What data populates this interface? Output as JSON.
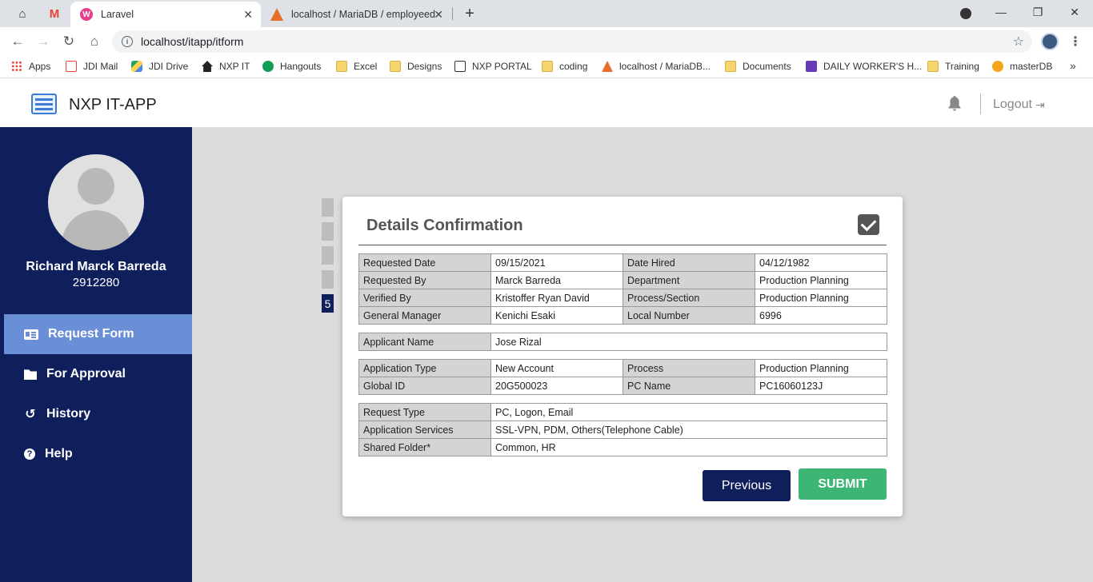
{
  "browser": {
    "tabs": [
      {
        "label": "Laravel"
      },
      {
        "label": "localhost / MariaDB / employeed"
      }
    ],
    "url": "localhost/itapp/itform",
    "bookmarks": [
      "Apps",
      "JDI Mail",
      "JDI Drive",
      "NXP IT",
      "Hangouts",
      "Excel",
      "Designs",
      "NXP PORTAL",
      "coding",
      "localhost / MariaDB...",
      "Documents",
      "DAILY WORKER'S H...",
      "Training",
      "masterDB"
    ],
    "more_bookmarks": "»"
  },
  "app": {
    "title": "NXP IT-APP",
    "logout_label": "Logout"
  },
  "sidebar": {
    "user_name": "Richard Marck Barreda",
    "user_id": "2912280",
    "items": [
      {
        "label": "Request Form",
        "active": true
      },
      {
        "label": "For Approval"
      },
      {
        "label": "History"
      },
      {
        "label": "Help"
      }
    ]
  },
  "steps": {
    "current": "5"
  },
  "card": {
    "title": "Details Confirmation",
    "section1": [
      [
        "Requested Date",
        "09/15/2021",
        "Date Hired",
        "04/12/1982"
      ],
      [
        "Requested By",
        "Marck Barreda",
        "Department",
        "Production Planning"
      ],
      [
        "Verified By",
        "Kristoffer Ryan David",
        "Process/Section",
        "Production Planning"
      ],
      [
        "General Manager",
        "Kenichi Esaki",
        "Local Number",
        "6996"
      ]
    ],
    "applicant": [
      "Applicant Name",
      "Jose Rizal"
    ],
    "section3": [
      [
        "Application Type",
        "New Account",
        "Process",
        "Production Planning"
      ],
      [
        "Global ID",
        "20G500023",
        "PC Name",
        "PC16060123J"
      ]
    ],
    "section4": [
      [
        "Request Type",
        "PC, Logon, Email"
      ],
      [
        "Application Services",
        "SSL-VPN, PDM, Others(Telephone Cable)"
      ],
      [
        "Shared Folder*",
        "Common, HR"
      ]
    ],
    "previous_label": "Previous",
    "submit_label": "SUBMIT"
  }
}
